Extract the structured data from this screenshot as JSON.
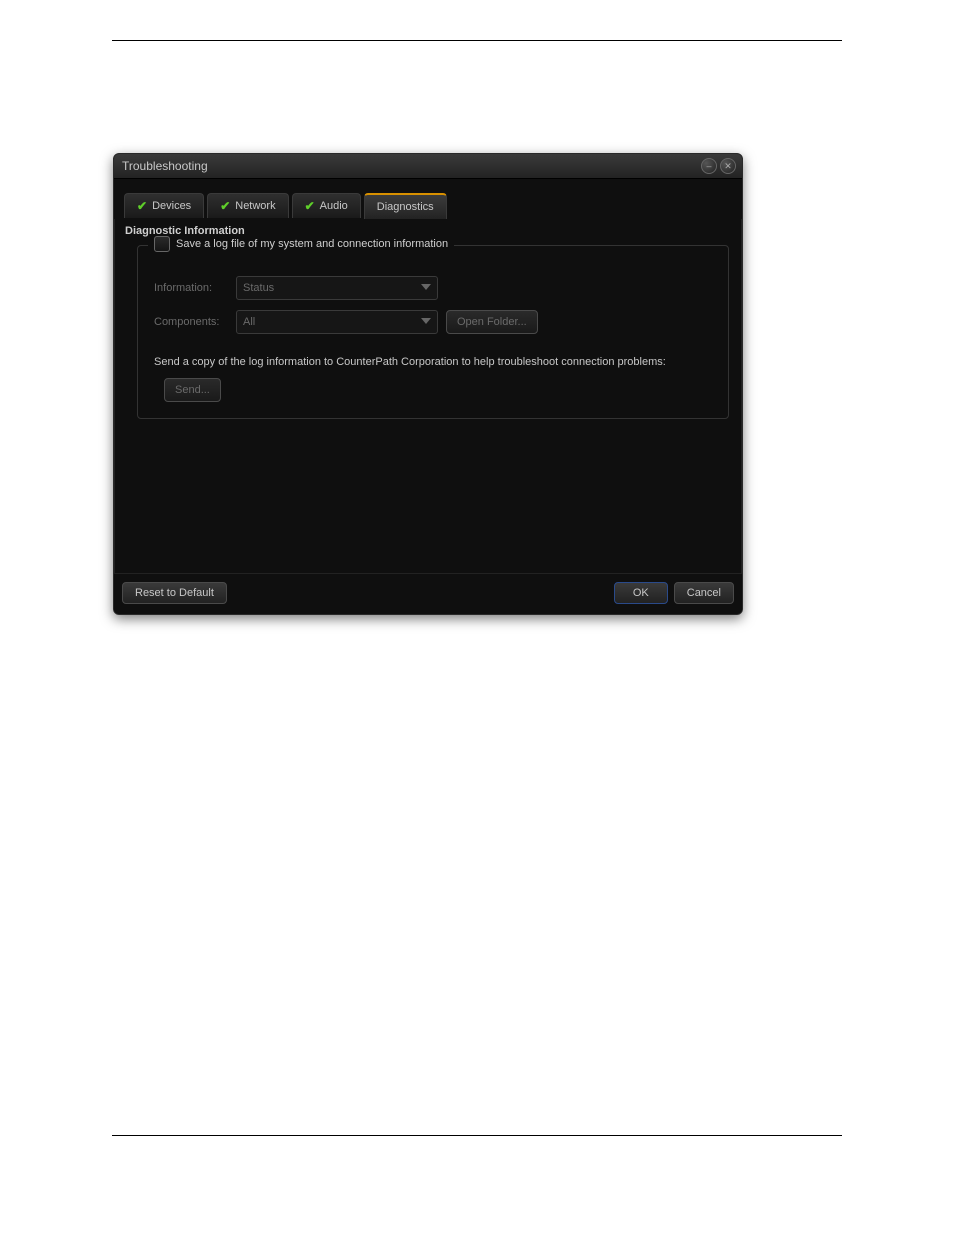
{
  "dialog": {
    "title": "Troubleshooting",
    "tabs": [
      {
        "label": "Devices",
        "has_check": true,
        "active": false
      },
      {
        "label": "Network",
        "has_check": true,
        "active": false
      },
      {
        "label": "Audio",
        "has_check": true,
        "active": false
      },
      {
        "label": "Diagnostics",
        "has_check": false,
        "active": true
      }
    ],
    "section_title": "Diagnostic Information",
    "checkbox_label": "Save a log file of my system and connection information",
    "rows": {
      "information": {
        "label": "Information:",
        "value": "Status"
      },
      "components": {
        "label": "Components:",
        "value": "All"
      }
    },
    "open_folder_label": "Open Folder...",
    "send_text": "Send a copy of the log information to CounterPath Corporation to help troubleshoot connection problems:",
    "send_button": "Send...",
    "footer": {
      "reset": "Reset to Default",
      "ok": "OK",
      "cancel": "Cancel"
    }
  }
}
